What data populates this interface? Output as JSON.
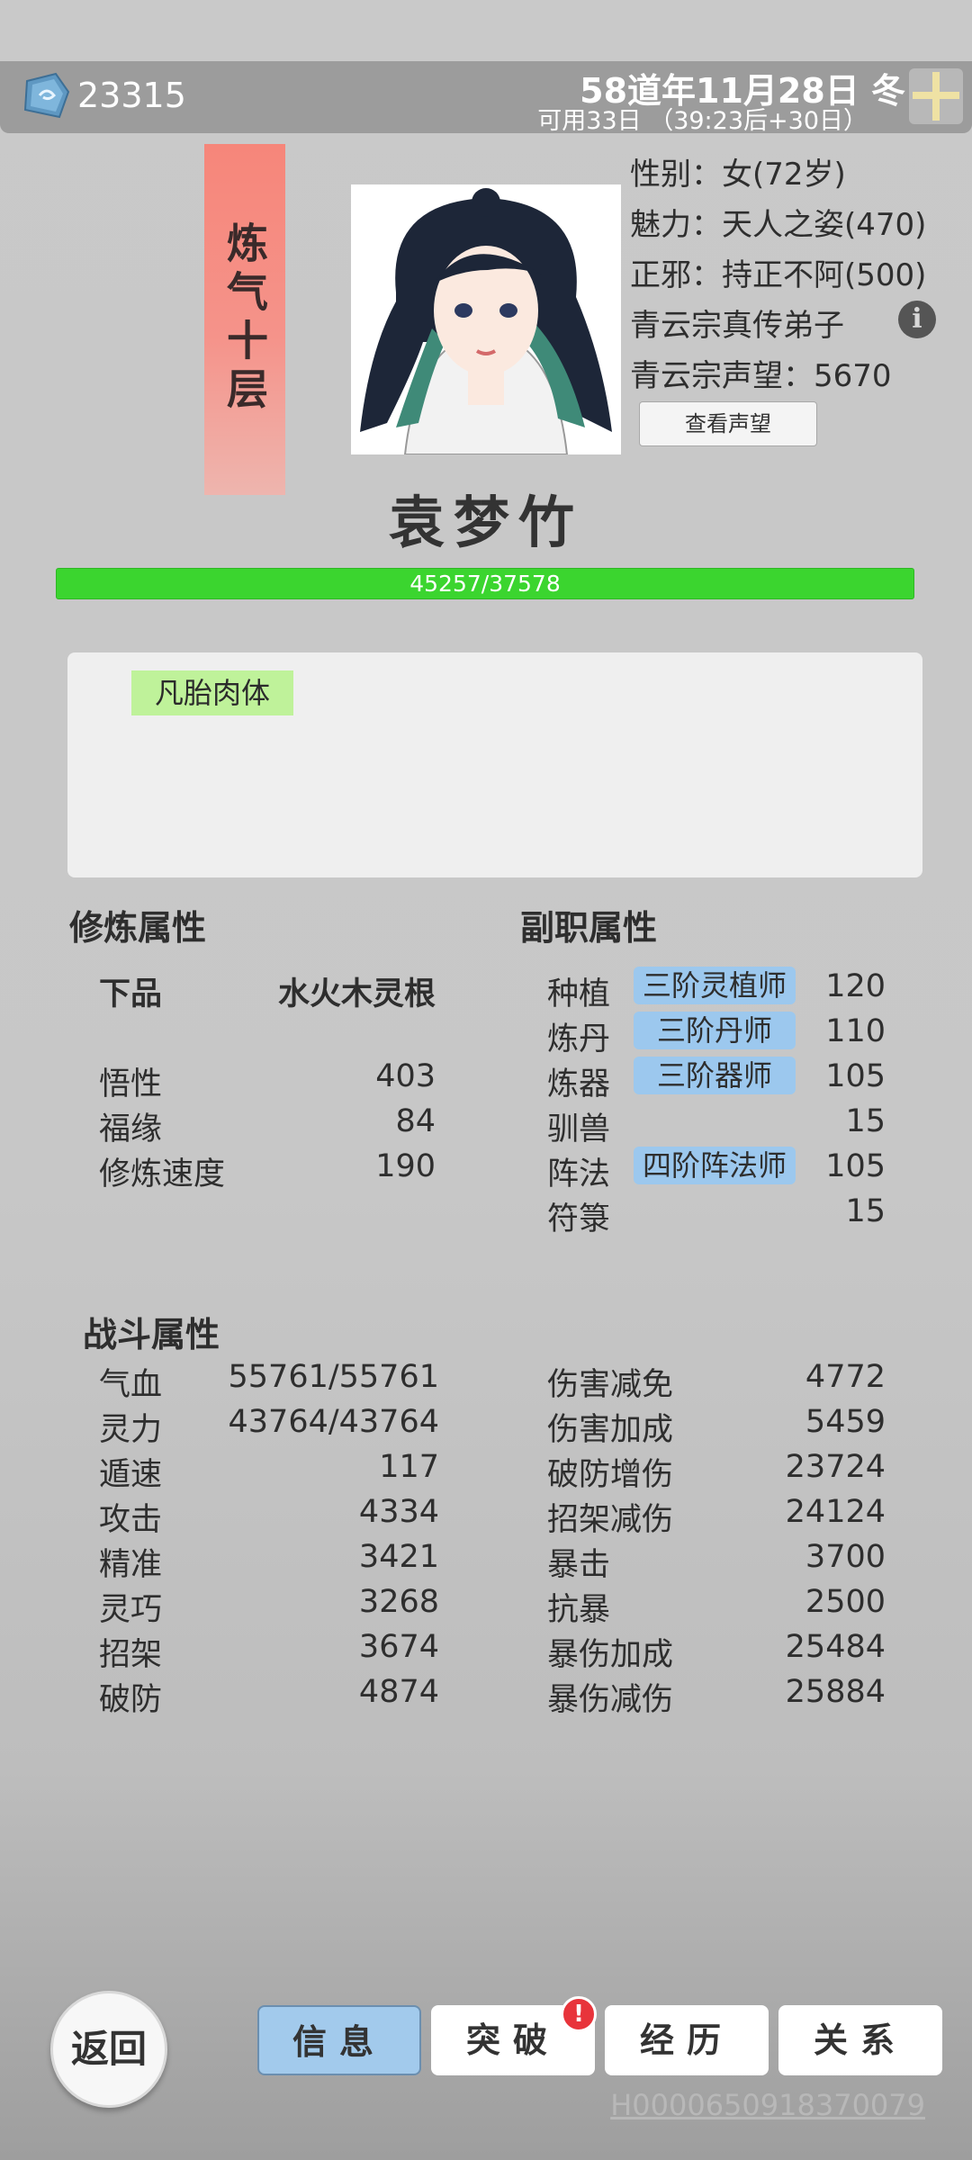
{
  "topbar": {
    "currency_icon": "spirit-stone-icon",
    "currency": "23315",
    "date": "58道年11月28日 冬",
    "available": "可用33日 （39:23后+30日）",
    "plus_icon": "plus-icon"
  },
  "character": {
    "realm": "炼气十层",
    "name": "袁梦竹",
    "gender": "性别：女(72岁)",
    "charm": "魅力：天人之姿(470)",
    "alignment": "正邪：持正不阿(500)",
    "sect_title": "青云宗真传弟子",
    "sect_reputation": "青云宗声望：5670",
    "view_reputation": "查看声望",
    "exp": "45257/37578",
    "exp_fraction": 1.0
  },
  "traits": [
    "凡胎肉体"
  ],
  "cultivation": {
    "title": "修炼属性",
    "grade": "下品",
    "root": "水火木灵根",
    "stats": [
      {
        "label": "悟性",
        "value": "403"
      },
      {
        "label": "福缘",
        "value": "84"
      },
      {
        "label": "修炼速度",
        "value": "190"
      }
    ]
  },
  "profession": {
    "title": "副职属性",
    "items": [
      {
        "label": "种植",
        "badge": "三阶灵植师",
        "value": "120"
      },
      {
        "label": "炼丹",
        "badge": "三阶丹师",
        "value": "110"
      },
      {
        "label": "炼器",
        "badge": "三阶器师",
        "value": "105"
      },
      {
        "label": "驯兽",
        "badge": "",
        "value": "15"
      },
      {
        "label": "阵法",
        "badge": "四阶阵法师",
        "value": "105"
      },
      {
        "label": "符箓",
        "badge": "",
        "value": "15"
      }
    ]
  },
  "combat": {
    "title": "战斗属性",
    "left": [
      {
        "label": "气血",
        "value": "55761/55761"
      },
      {
        "label": "灵力",
        "value": "43764/43764"
      },
      {
        "label": "遁速",
        "value": "117"
      },
      {
        "label": "攻击",
        "value": "4334"
      },
      {
        "label": "精准",
        "value": "3421"
      },
      {
        "label": "灵巧",
        "value": "3268"
      },
      {
        "label": "招架",
        "value": "3674"
      },
      {
        "label": "破防",
        "value": "4874"
      }
    ],
    "right": [
      {
        "label": "伤害减免",
        "value": "4772"
      },
      {
        "label": "伤害加成",
        "value": "5459"
      },
      {
        "label": "破防增伤",
        "value": "23724"
      },
      {
        "label": "招架减伤",
        "value": "24124"
      },
      {
        "label": "暴击",
        "value": "3700"
      },
      {
        "label": "抗暴",
        "value": "2500"
      },
      {
        "label": "暴伤加成",
        "value": "25484"
      },
      {
        "label": "暴伤减伤",
        "value": "25884"
      }
    ]
  },
  "bottom": {
    "back": "返回",
    "tabs": [
      "信息",
      "突破",
      "经历",
      "关系"
    ],
    "alert_mark": "!",
    "uid": "H0000650918370079"
  },
  "colors": {
    "realm_banner": "#f6867a",
    "exp_bar": "#3bd52f",
    "trait_bg": "#bff29a",
    "badge_bg": "#9cc8ee",
    "active_tab": "#a2caec"
  }
}
